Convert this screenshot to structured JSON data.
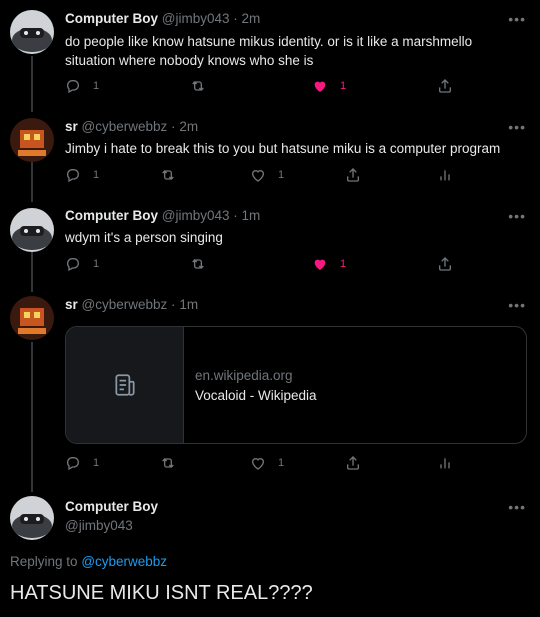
{
  "tweets": [
    {
      "name": "Computer Boy",
      "handle": "@jimby043",
      "time": "2m",
      "text": "do people like know hatsune mikus identity. or is it like a marshmello situation where nobody knows who she is",
      "replies": "1",
      "likes": "1"
    },
    {
      "name": "sr",
      "handle": "@cyberwebbz",
      "time": "2m",
      "text": "Jimby i hate to break this to you but hatsune miku is a computer program",
      "replies": "1",
      "likes": "1"
    },
    {
      "name": "Computer Boy",
      "handle": "@jimby043",
      "time": "1m",
      "text": "wdym it's a person singing",
      "replies": "1",
      "likes": "1"
    },
    {
      "name": "sr",
      "handle": "@cyberwebbz",
      "time": "1m",
      "card": {
        "domain": "en.wikipedia.org",
        "title": "Vocaloid - Wikipedia"
      },
      "replies": "1",
      "likes": "1"
    }
  ],
  "focus": {
    "name": "Computer Boy",
    "handle": "@jimby043",
    "replying_prefix": "Replying to",
    "replying_to": "@cyberwebbz",
    "text": "HATSUNE MIKU ISNT REAL????"
  },
  "separator": "·",
  "more": "•••",
  "colors": {
    "like": "#f91880",
    "link": "#1d9bf0",
    "muted": "#71767b",
    "text": "#e7e9ea"
  },
  "icons": {
    "reply": "reply-icon",
    "retweet": "retweet-icon",
    "like": "heart-icon",
    "share": "share-icon",
    "analytics": "analytics-icon",
    "article": "article-icon"
  }
}
